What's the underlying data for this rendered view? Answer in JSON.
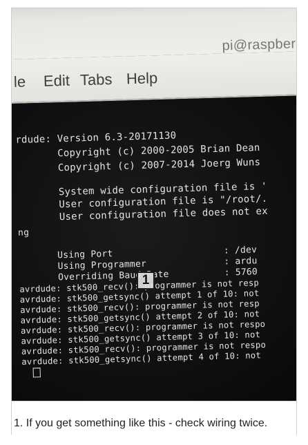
{
  "window": {
    "title": "pi@raspberry"
  },
  "menu": {
    "items": [
      "le",
      "Edit",
      "Tabs",
      "Help"
    ]
  },
  "terminal": {
    "lines": [
      "rdude: Version 6.3-20171130",
      "       Copyright (c) 2000-2005 Brian Dean",
      "       Copyright (c) 2007-2014 Joerg Wuns",
      "       System wide configuration file is '",
      "       User configuration file is \"/root/.",
      "       User configuration file does not ex",
      "ng",
      "       Using Port                    : /dev",
      "       Using Programmer              : ardu",
      "       Overriding Baud Rate          : 5760",
      "avrdude: stk500_recv(): programmer is not resp",
      "avrdude: stk500_getsync() attempt 1 of 10: not",
      "avrdude: stk500_recv(): programmer is not resp",
      "avrdude: stk500_getsync() attempt 2 of 10: not",
      "avrdude: stk500_recv(): programmer is not respo",
      "avrdude: stk500_getsync() attempt 3 of 10: not",
      "avrdude: stk500_recv(): programmer is not respo",
      "avrdude: stk500_getsync() attempt 4 of 10: not"
    ]
  },
  "marker": {
    "label": "1"
  },
  "caption": {
    "text": "1. If you get something like this - check wiring twice."
  },
  "colors": {
    "terminal_bg": "#0c0c0d",
    "terminal_fg": "#e4e4e4",
    "menubar_bg": "#e7e8e3"
  }
}
